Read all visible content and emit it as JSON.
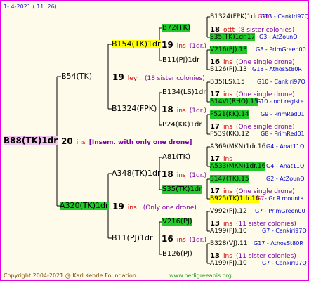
{
  "header": {
    "date": "1-   4-2021  (  11:  26)"
  },
  "footer": {
    "copyright": "Copyright 2004-2021 @ Karl Kehrle Foundation",
    "site": "www.pedigreeapis.org"
  },
  "gen0": {
    "name": "B88(TK)1dr",
    "count": "20",
    "ins": "ins",
    "desc": "[Insem. with only one drone]"
  },
  "gen1": {
    "top": {
      "name": "B54(TK)",
      "count": "19",
      "ins": "leyh",
      "desc": "(18 sister colonies)"
    },
    "bottom": {
      "name": "A320(TK)1dr",
      "count": "19",
      "ins": "ins",
      "desc": "(Only one drone)"
    }
  },
  "gen2": {
    "a": {
      "name": "B154(TK)1dr",
      "count": "19",
      "ins": "ins",
      "desc": "(1dr.)"
    },
    "b": {
      "name": "B1324(FPK)",
      "count": "18",
      "ins": "ins",
      "desc": "(1dr.)"
    },
    "c": {
      "name": "A348(TK)1dr",
      "count": "18",
      "ins": "ins",
      "desc": "(1dr.)"
    },
    "d": {
      "name": "B11(PJ)1dr",
      "count": "16",
      "ins": "ins",
      "desc": "(1dr.)"
    }
  },
  "gen3": [
    {
      "name": "B72(TK)",
      "count": "18",
      "ins": "ottt",
      "desc": "(8 sister colonies)"
    },
    {
      "name": "B11(PJ)1dr",
      "count": "16",
      "ins": "ins",
      "desc": "(One single drone)"
    },
    {
      "name": "B134(LS)1dr",
      "count": "17",
      "ins": "ins",
      "desc": "(One single drone)"
    },
    {
      "name": "P24(KK)1dr",
      "count": "17",
      "ins": "ins",
      "desc": "(One single drone)"
    },
    {
      "name": "A81(TK)",
      "count": "17",
      "ins": "ins",
      "desc": ""
    },
    {
      "name": "S35(TK)1dr",
      "count": "17",
      "ins": "ins",
      "desc": "(One single drone)"
    },
    {
      "name": "V216(PJ)",
      "count": "13",
      "ins": "ins",
      "desc": "(11 sister colonies)"
    },
    {
      "name": "B126(PJ)",
      "count": "13",
      "ins": "ins",
      "desc": "(11 sister colonies)"
    }
  ],
  "gen4": [
    {
      "name": "B1324(FPK)1dr",
      "note": "G13 - Cankiri97Q",
      "extra": "G10"
    },
    {
      "name": "S35(TK)1dr.17",
      "note": "G3 - AtZounQ"
    },
    {
      "name": "V216(PJ).13",
      "note": "G8 - PrimGreen00"
    },
    {
      "name": "B126(PJ).13",
      "note": "G18 - AthosSt80R"
    },
    {
      "name": "B35(LS).15",
      "note": "G10 - Cankiri97Q"
    },
    {
      "name": "B14Vt(RHO).15",
      "note": "G10 - not registe"
    },
    {
      "name": "P521(KK).14",
      "note": "G9 - PrimRed01"
    },
    {
      "name": "P539(KK).12",
      "note": "G8 - PrimRed01"
    },
    {
      "name": "A369(MKN)1dr.16",
      "note": "G4 - Anat11Q"
    },
    {
      "name": "A533(MKN)1dr.16",
      "note": "G4 - Anat11Q"
    },
    {
      "name": "S147(TK).15",
      "note": "G2 - AtZounQ"
    },
    {
      "name": "B925(TK)1dr.16",
      "note": "- Gr.R.mounta",
      "extra": "G7"
    },
    {
      "name": "V992(PJ).12",
      "note": "G7 - PrimGreen00"
    },
    {
      "name": "A199(PJ).10",
      "note": "G7 - Cankiri97Q"
    },
    {
      "name": "B328(VJ).11",
      "note": "G17 - AthosSt80R"
    },
    {
      "name": "A199(PJ).10",
      "note": "G7 - Cankiri97Q"
    }
  ]
}
